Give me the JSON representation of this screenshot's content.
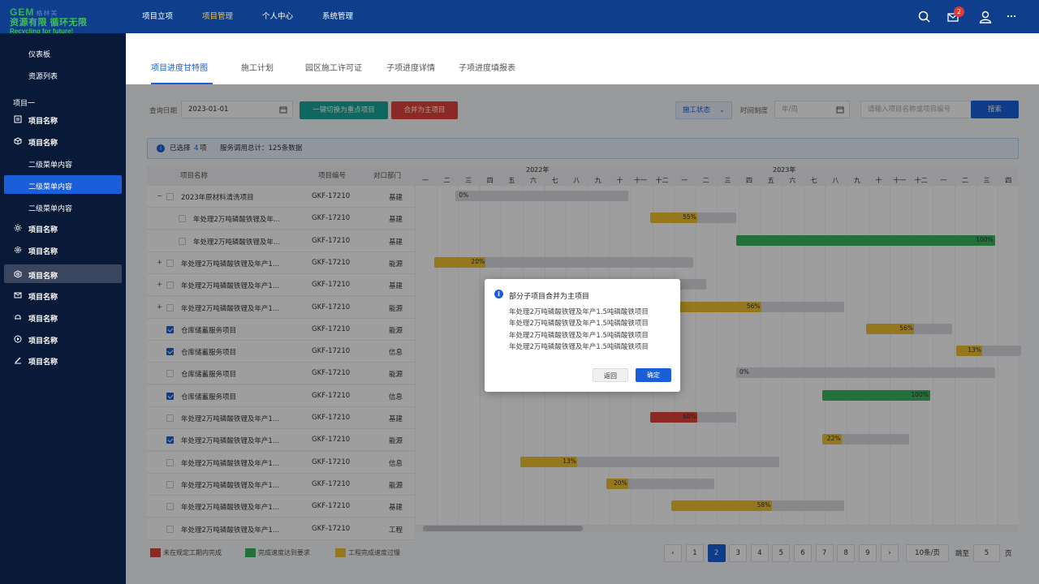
{
  "logo": {
    "brand": "GEM",
    "brand_sub": "格林美",
    "slogan_cn": "资源有限 循环无限",
    "slogan_en": "Recycling for future!"
  },
  "header": {
    "nav": [
      "项目立项",
      "项目管理",
      "个人中心",
      "系统管理"
    ],
    "active_nav": "项目管理",
    "badge_count": "2"
  },
  "sidebar": {
    "top_items": [
      "仪表板",
      "资源列表"
    ],
    "group_title": "项目一",
    "items": [
      {
        "label": "项目名称",
        "icon": "document-icon"
      },
      {
        "label": "项目名称",
        "icon": "cube-icon"
      },
      {
        "label": "二级菜单内容"
      },
      {
        "label": "二级菜单内容",
        "selected": true
      },
      {
        "label": "二级菜单内容"
      },
      {
        "label": "项目名称",
        "icon": "sun-icon"
      },
      {
        "label": "项目名称",
        "icon": "settings-icon"
      },
      {
        "label": "项目名称",
        "icon": "hexagon-icon",
        "hover": true
      },
      {
        "label": "项目名称",
        "icon": "mail-icon"
      },
      {
        "label": "项目名称",
        "icon": "bell-icon"
      },
      {
        "label": "项目名称",
        "icon": "play-icon"
      },
      {
        "label": "项目名称",
        "icon": "pen-icon"
      }
    ]
  },
  "tabs": [
    "项目进度甘特图",
    "施工计划",
    "园区施工许可证",
    "子项进度详情",
    "子项进度填报表"
  ],
  "filters": {
    "query_date_label": "查询日期",
    "query_date_value": "2023-01-01",
    "switch_button": "一键切换为重点项目",
    "merge_button": "合并为主项目",
    "status_select": "施工状态",
    "time_scale_label": "时间刻度",
    "time_scale_placeholder": "年/周",
    "search_placeholder": "请输入项目名称或项目编号",
    "search_button": "搜索"
  },
  "info_bar": {
    "selected_prefix": "已选择",
    "selected_count": "4",
    "selected_suffix": "项",
    "service_text": "服务调用总计：125条数据"
  },
  "table": {
    "headers": [
      "项目名称",
      "项目编号",
      "对口部门"
    ],
    "rows": [
      {
        "name": "2023年原材料清洗项目",
        "code": "GKF-17210",
        "dept": "基建",
        "level": 0,
        "expand": "−",
        "checked": false
      },
      {
        "name": "年处理2万吨磷酸铁锂及年...",
        "code": "GKF-17210",
        "dept": "基建",
        "level": 1,
        "expand": "",
        "checked": false
      },
      {
        "name": "年处理2万吨磷酸铁锂及年...",
        "code": "GKF-17210",
        "dept": "基建",
        "level": 1,
        "expand": "",
        "checked": false
      },
      {
        "name": "年处理2万吨磷酸铁锂及年产1...",
        "code": "GKF-17210",
        "dept": "能源",
        "level": 0,
        "expand": "+",
        "checked": false
      },
      {
        "name": "年处理2万吨磷酸铁锂及年产1...",
        "code": "GKF-17210",
        "dept": "基建",
        "level": 0,
        "expand": "+",
        "checked": false
      },
      {
        "name": "年处理2万吨磷酸铁锂及年产1...",
        "code": "GKF-17210",
        "dept": "能源",
        "level": 0,
        "expand": "+",
        "checked": false
      },
      {
        "name": "仓库储蓄服务项目",
        "code": "GKF-17210",
        "dept": "能源",
        "level": 0,
        "expand": "",
        "checked": true
      },
      {
        "name": "仓库储蓄服务项目",
        "code": "GKF-17210",
        "dept": "信息",
        "level": 0,
        "expand": "",
        "checked": true
      },
      {
        "name": "仓库储蓄服务项目",
        "code": "GKF-17210",
        "dept": "能源",
        "level": 0,
        "expand": "",
        "checked": false
      },
      {
        "name": "仓库储蓄服务项目",
        "code": "GKF-17210",
        "dept": "信息",
        "level": 0,
        "expand": "",
        "checked": true
      },
      {
        "name": "年处理2万吨磷酸铁锂及年产1...",
        "code": "GKF-17210",
        "dept": "基建",
        "level": 0,
        "expand": "",
        "checked": false
      },
      {
        "name": "年处理2万吨磷酸铁锂及年产1...",
        "code": "GKF-17210",
        "dept": "能源",
        "level": 0,
        "expand": "",
        "checked": true
      },
      {
        "name": "年处理2万吨磷酸铁锂及年产1...",
        "code": "GKF-17210",
        "dept": "信息",
        "level": 0,
        "expand": "",
        "checked": false
      },
      {
        "name": "年处理2万吨磷酸铁锂及年产1...",
        "code": "GKF-17210",
        "dept": "能源",
        "level": 0,
        "expand": "",
        "checked": false
      },
      {
        "name": "年处理2万吨磷酸铁锂及年产1...",
        "code": "GKF-17210",
        "dept": "基建",
        "level": 0,
        "expand": "",
        "checked": false
      },
      {
        "name": "年处理2万吨磷酸铁锂及年产1...",
        "code": "GKF-17210",
        "dept": "工程",
        "level": 0,
        "expand": "",
        "checked": false
      }
    ]
  },
  "gantt": {
    "years": [
      "2022年",
      "2023年"
    ],
    "months": [
      "一",
      "二",
      "三",
      "四",
      "五",
      "六",
      "七",
      "八",
      "九",
      "十",
      "十一",
      "十二",
      "一",
      "二",
      "三",
      "四",
      "五",
      "六",
      "七",
      "八",
      "九",
      "十",
      "十一",
      "十二",
      "一",
      "二",
      "三",
      "四"
    ],
    "colors": {
      "red": "#e0453a",
      "green": "#3bb560",
      "yellow": "#f0c230",
      "grey": "#d9dbe0"
    },
    "bars": [
      {
        "start": 2,
        "span": 8,
        "progress": 0,
        "label": "0%",
        "color": "grey"
      },
      {
        "start": 11,
        "span": 4,
        "progress": 55,
        "label": "55%",
        "color": "yellow"
      },
      {
        "start": 15,
        "span": 12,
        "progress": 100,
        "label": "100%",
        "color": "green"
      },
      {
        "start": 1,
        "span": 12,
        "progress": 20,
        "label": "20%",
        "color": "yellow"
      },
      {
        "start": 12,
        "span": 1.6,
        "progress": 0,
        "label": "",
        "color": "grey"
      },
      {
        "start": 12,
        "span": 8,
        "progress": 52,
        "label": "56%",
        "color": "yellow"
      },
      {
        "start": 21,
        "span": 4,
        "progress": 56,
        "label": "56%",
        "color": "yellow"
      },
      {
        "start": 25.2,
        "span": 3,
        "progress": 40,
        "label": "13%",
        "color": "yellow"
      },
      {
        "start": 15,
        "span": 12,
        "progress": 0,
        "label": "0%",
        "color": "grey"
      },
      {
        "start": 19,
        "span": 5,
        "progress": 100,
        "label": "100%",
        "color": "green"
      },
      {
        "start": 11,
        "span": 4,
        "progress": 55,
        "label": "60%",
        "color": "red"
      },
      {
        "start": 19,
        "span": 4,
        "progress": 22,
        "label": "22%",
        "color": "yellow"
      },
      {
        "start": 5,
        "span": 12,
        "progress": 22,
        "label": "13%",
        "color": "yellow"
      },
      {
        "start": 9,
        "span": 5,
        "progress": 20,
        "label": "20%",
        "color": "yellow"
      },
      {
        "start": 12,
        "span": 8,
        "progress": 58,
        "label": "58%",
        "color": "yellow"
      }
    ]
  },
  "legend": [
    "未在规定工期内完成",
    "完成速度达到要求",
    "工程完成速度过慢"
  ],
  "pagination": {
    "pages": [
      "1",
      "2",
      "3",
      "4",
      "5",
      "6",
      "7",
      "8",
      "9"
    ],
    "active": "2",
    "page_size": "10条/页",
    "jump_label": "跳至",
    "jump_value": "5",
    "page_suffix": "页"
  },
  "modal": {
    "title": "部分子项目合并为主项目",
    "lines": [
      "年处理2万吨磷酸铁锂及年产1.5吨磷酸铁项目",
      "年处理2万吨磷酸铁锂及年产1.5吨磷酸铁项目",
      "年处理2万吨磷酸铁锂及年产1.5吨磷酸铁项目",
      "年处理2万吨磷酸铁锂及年产1.5吨磷酸铁项目"
    ],
    "cancel": "返回",
    "confirm": "确定"
  }
}
